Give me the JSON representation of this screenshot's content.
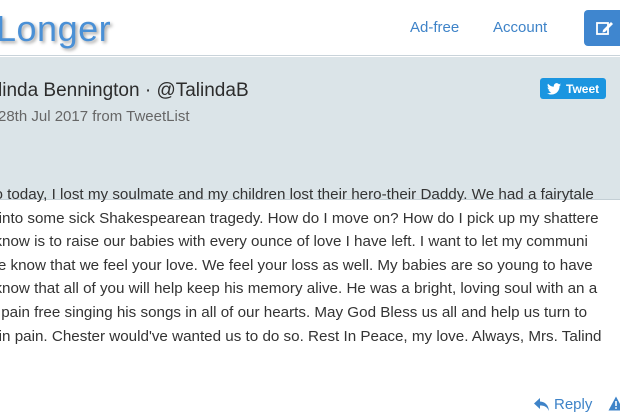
{
  "navbar": {
    "brand": "Longer",
    "links": [
      "Ad-free",
      "Account"
    ],
    "write_icon": "edit-icon"
  },
  "tweet": {
    "author": "linda Bennington · @TalindaB",
    "meta": "28th Jul 2017 from TweetList",
    "tweet_button": "Tweet",
    "body_lines": [
      "go today, I lost my soulmate and my children lost their hero-their Daddy. We had a fairytale",
      "d into some sick Shakespearean tragedy. How do I move on? How do I pick up my shattere",
      "I know is to raise our babies with every ounce of love I have left. I want to let my communi",
      "ide know that we feel your love. We feel your loss as well. My babies are so young to have",
      "I know that all of you will help keep his memory alive. He was a bright, loving soul with an a",
      "is pain free singing his songs in all of our hearts. May God Bless us all and help us turn to",
      "e in pain. Chester would've wanted us to do so. Rest In Peace, my love. Always, Mrs. Talind"
    ]
  },
  "actions": {
    "reply": "Reply",
    "reply_icon": "reply-icon",
    "flag_icon": "warning-icon"
  },
  "colors": {
    "accent": "#3f86cf",
    "header_bg": "#dbe4e8",
    "twitter_blue": "#1b95e0"
  }
}
